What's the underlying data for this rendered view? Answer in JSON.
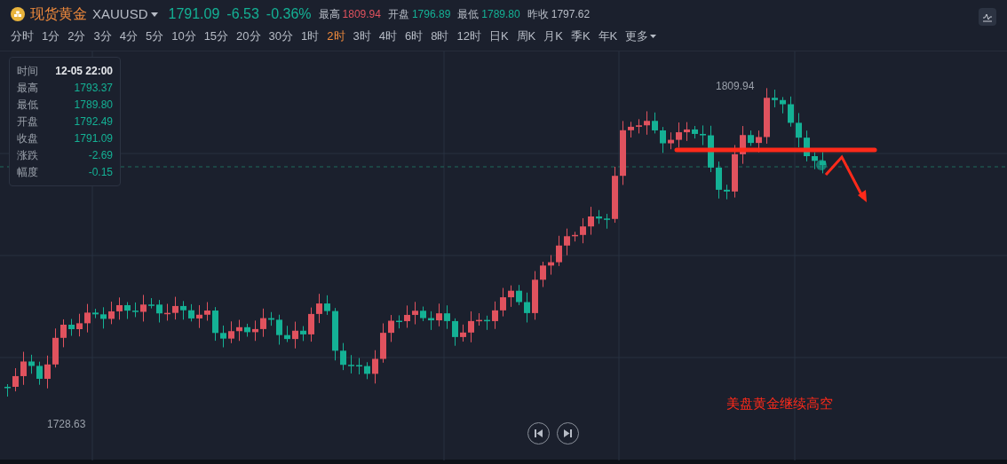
{
  "header": {
    "name": "现货黄金",
    "symbol": "XAUUSD",
    "price": "1791.09",
    "change": "-6.53",
    "change_pct": "-0.36%",
    "stats": [
      {
        "label": "最高",
        "value": "1809.94",
        "color": "#e0525e"
      },
      {
        "label": "开盘",
        "value": "1796.89",
        "color": "#14b195"
      },
      {
        "label": "最低",
        "value": "1789.80",
        "color": "#14b195"
      },
      {
        "label": "昨收",
        "value": "1797.62",
        "color": "#b7bcc6"
      }
    ]
  },
  "timeframes": [
    {
      "label": "分时",
      "selected": false
    },
    {
      "label": "1分",
      "selected": false
    },
    {
      "label": "2分",
      "selected": false
    },
    {
      "label": "3分",
      "selected": false
    },
    {
      "label": "4分",
      "selected": false
    },
    {
      "label": "5分",
      "selected": false
    },
    {
      "label": "10分",
      "selected": false
    },
    {
      "label": "15分",
      "selected": false
    },
    {
      "label": "20分",
      "selected": false
    },
    {
      "label": "30分",
      "selected": false
    },
    {
      "label": "1时",
      "selected": false
    },
    {
      "label": "2时",
      "selected": true
    },
    {
      "label": "3时",
      "selected": false
    },
    {
      "label": "4时",
      "selected": false
    },
    {
      "label": "6时",
      "selected": false
    },
    {
      "label": "8时",
      "selected": false
    },
    {
      "label": "12时",
      "selected": false
    },
    {
      "label": "日K",
      "selected": false
    },
    {
      "label": "周K",
      "selected": false
    },
    {
      "label": "月K",
      "selected": false
    },
    {
      "label": "季K",
      "selected": false
    },
    {
      "label": "年K",
      "selected": false
    }
  ],
  "more_menu": "更多",
  "info_panel": {
    "time_label": "时间",
    "time": "12-05 22:00",
    "rows": [
      {
        "label": "最高",
        "value": "1793.37"
      },
      {
        "label": "最低",
        "value": "1789.80"
      },
      {
        "label": "开盘",
        "value": "1792.49"
      },
      {
        "label": "收盘",
        "value": "1791.09"
      },
      {
        "label": "涨跌",
        "value": "-2.69"
      },
      {
        "label": "幅度",
        "value": "-0.15"
      }
    ]
  },
  "chart": {
    "high_label": "1809.94",
    "low_label": "1728.63",
    "annotation": "美盘黄金继续高空"
  }
}
